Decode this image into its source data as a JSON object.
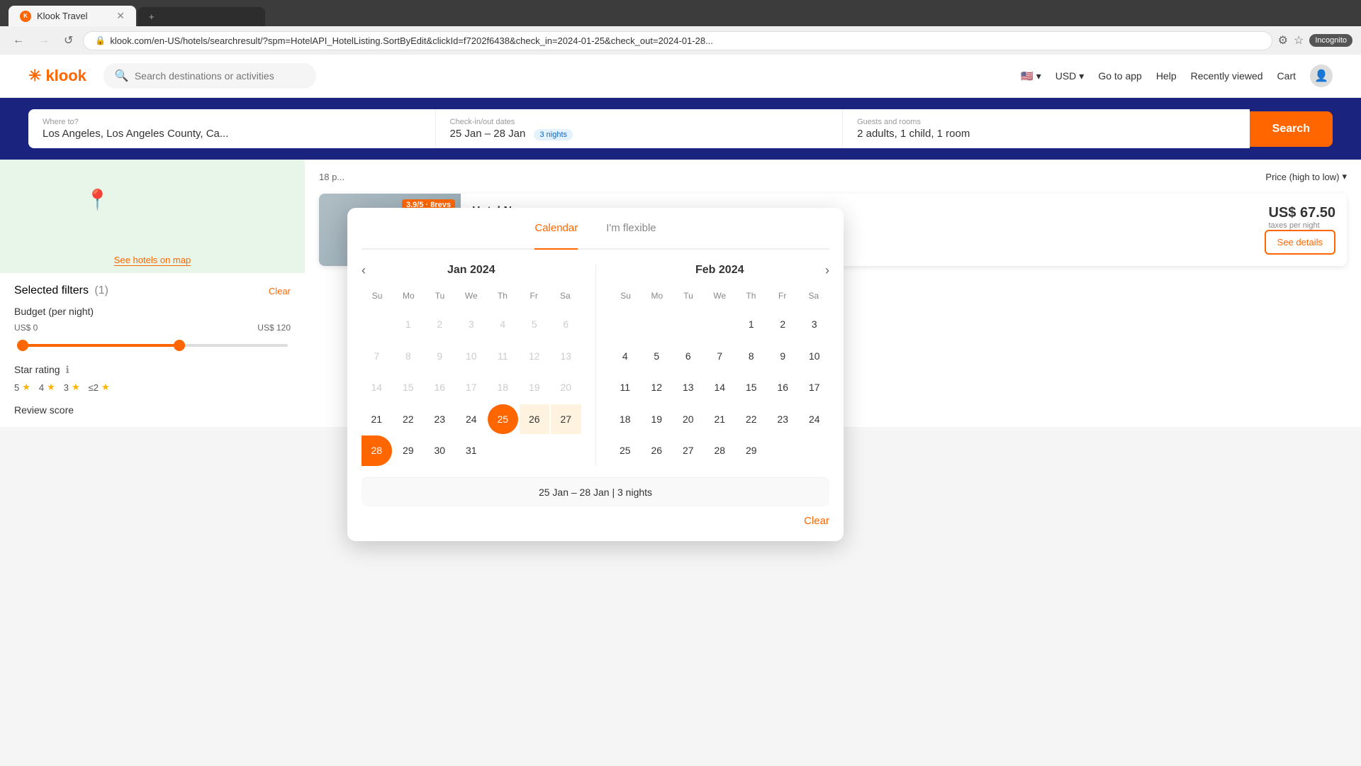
{
  "browser": {
    "tab_title": "Klook Travel",
    "url": "klook.com/en-US/hotels/searchresult/?spm=HotelAPI_HotelListing.SortByEdit&clickId=f7202f6438&check_in=2024-01-25&check_out=2024-01-28...",
    "nav_back": "←",
    "nav_forward": "→",
    "nav_refresh": "↺",
    "incognito": "Incognito"
  },
  "header": {
    "logo_text": "klook",
    "search_placeholder": "Search destinations or activities",
    "nav_items": [
      "Go to app",
      "Help",
      "Recently viewed",
      "Cart"
    ],
    "currency": "USD",
    "flag": "🇺🇸"
  },
  "hero": {
    "where_label": "Where to?",
    "where_value": "Los Angeles, Los Angeles County, Ca...",
    "checkin_label": "Check-in/out dates",
    "checkin_value": "25 Jan – 28 Jan",
    "nights_badge": "3 nights",
    "guests_label": "Guests and rooms",
    "guests_value": "2 adults, 1 child, 1 room",
    "search_btn": "Search"
  },
  "map": {
    "see_on_map": "See hotels on map"
  },
  "filters": {
    "title": "Selected filters",
    "count": "(1)",
    "clear_label": "Clear",
    "budget_label": "Budget (per night)",
    "budget_min": "US$ 0",
    "budget_max": "US$ 120",
    "star_label": "Star rating",
    "star_info": "ℹ",
    "star_options": [
      "5★",
      "4★",
      "3★",
      "≤2★"
    ],
    "review_label": "Review score"
  },
  "listing": {
    "count": "18 p...",
    "sort_label": "Price (high to low)",
    "hotels": [
      {
        "name": "Hotel Name",
        "rating": "3.9/5",
        "reviews": "8 revs",
        "price": "US$ 67.50",
        "price_label": "taxes per night",
        "see_details": "See details"
      }
    ]
  },
  "calendar": {
    "tab_calendar": "Calendar",
    "tab_flexible": "I'm flexible",
    "jan_title": "Jan 2024",
    "feb_title": "Feb 2024",
    "day_headers": [
      "Su",
      "Mo",
      "Tu",
      "We",
      "Th",
      "Fr",
      "Sa"
    ],
    "jan_days": [
      {
        "day": "",
        "state": "empty"
      },
      {
        "day": "1",
        "state": "disabled"
      },
      {
        "day": "2",
        "state": "disabled"
      },
      {
        "day": "3",
        "state": "disabled"
      },
      {
        "day": "4",
        "state": "disabled"
      },
      {
        "day": "5",
        "state": "disabled"
      },
      {
        "day": "6",
        "state": "disabled"
      },
      {
        "day": "7",
        "state": "disabled"
      },
      {
        "day": "8",
        "state": "disabled"
      },
      {
        "day": "9",
        "state": "disabled"
      },
      {
        "day": "10",
        "state": "disabled"
      },
      {
        "day": "11",
        "state": "disabled"
      },
      {
        "day": "12",
        "state": "disabled"
      },
      {
        "day": "13",
        "state": "disabled"
      },
      {
        "day": "14",
        "state": "disabled"
      },
      {
        "day": "15",
        "state": "disabled"
      },
      {
        "day": "16",
        "state": "disabled"
      },
      {
        "day": "17",
        "state": "disabled"
      },
      {
        "day": "18",
        "state": "disabled"
      },
      {
        "day": "19",
        "state": "disabled"
      },
      {
        "day": "20",
        "state": "disabled"
      },
      {
        "day": "21",
        "state": "normal"
      },
      {
        "day": "22",
        "state": "normal"
      },
      {
        "day": "23",
        "state": "normal"
      },
      {
        "day": "24",
        "state": "normal"
      },
      {
        "day": "25",
        "state": "selected"
      },
      {
        "day": "26",
        "state": "in-range"
      },
      {
        "day": "27",
        "state": "in-range"
      },
      {
        "day": "28",
        "state": "range-end"
      },
      {
        "day": "29",
        "state": "normal"
      },
      {
        "day": "30",
        "state": "normal"
      },
      {
        "day": "31",
        "state": "normal"
      }
    ],
    "feb_days": [
      {
        "day": "",
        "state": "empty"
      },
      {
        "day": "",
        "state": "empty"
      },
      {
        "day": "",
        "state": "empty"
      },
      {
        "day": "",
        "state": "empty"
      },
      {
        "day": "1",
        "state": "normal"
      },
      {
        "day": "2",
        "state": "normal"
      },
      {
        "day": "3",
        "state": "normal"
      },
      {
        "day": "4",
        "state": "normal"
      },
      {
        "day": "5",
        "state": "normal"
      },
      {
        "day": "6",
        "state": "normal"
      },
      {
        "day": "7",
        "state": "normal"
      },
      {
        "day": "8",
        "state": "normal"
      },
      {
        "day": "9",
        "state": "normal"
      },
      {
        "day": "10",
        "state": "normal"
      },
      {
        "day": "11",
        "state": "normal"
      },
      {
        "day": "12",
        "state": "normal"
      },
      {
        "day": "13",
        "state": "normal"
      },
      {
        "day": "14",
        "state": "normal"
      },
      {
        "day": "15",
        "state": "normal"
      },
      {
        "day": "16",
        "state": "normal"
      },
      {
        "day": "17",
        "state": "normal"
      },
      {
        "day": "18",
        "state": "normal"
      },
      {
        "day": "19",
        "state": "normal"
      },
      {
        "day": "20",
        "state": "normal"
      },
      {
        "day": "21",
        "state": "normal"
      },
      {
        "day": "22",
        "state": "normal"
      },
      {
        "day": "23",
        "state": "normal"
      },
      {
        "day": "24",
        "state": "normal"
      },
      {
        "day": "25",
        "state": "normal"
      },
      {
        "day": "26",
        "state": "normal"
      },
      {
        "day": "27",
        "state": "normal"
      },
      {
        "day": "28",
        "state": "normal"
      },
      {
        "day": "29",
        "state": "normal"
      }
    ],
    "date_summary": "25 Jan – 28 Jan | 3 nights",
    "clear_btn": "Clear"
  },
  "colors": {
    "orange": "#ff6600",
    "blue_dark": "#1a237e",
    "range_bg": "#fff3e0"
  }
}
